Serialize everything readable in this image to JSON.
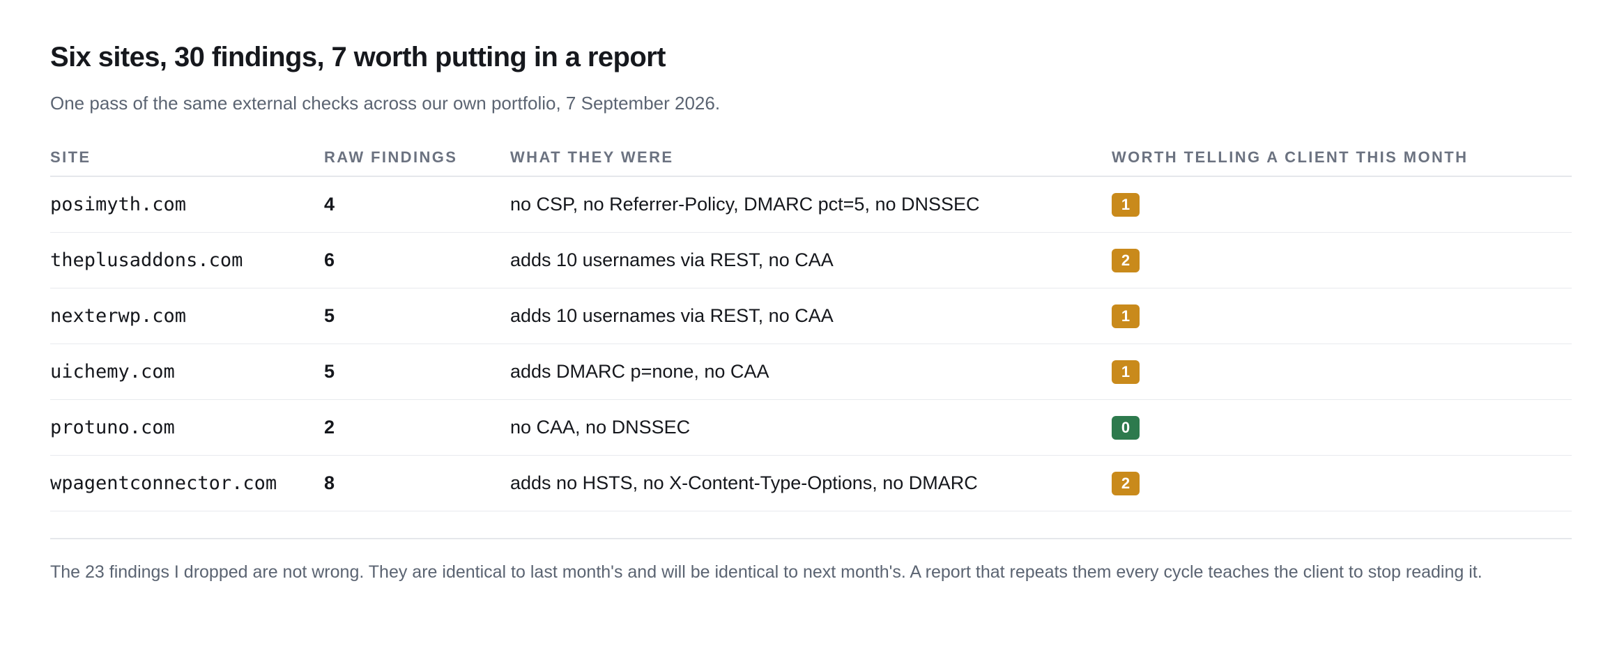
{
  "report": {
    "title": "Six sites, 30 findings, 7 worth putting in a report",
    "subtitle": "One pass of the same external checks across our own portfolio, 7 September 2026."
  },
  "table": {
    "headers": {
      "site": "SITE",
      "raw": "RAW FINDINGS",
      "what": "WHAT THEY WERE",
      "worth": "WORTH TELLING A CLIENT THIS MONTH"
    },
    "rows": [
      {
        "site": "posimyth.com",
        "raw": "4",
        "what": "no CSP, no Referrer-Policy, DMARC pct=5, no DNSSEC",
        "worth": "1",
        "badge_color": "#c98a1b"
      },
      {
        "site": "theplusaddons.com",
        "raw": "6",
        "what": "adds 10 usernames via REST, no CAA",
        "worth": "2",
        "badge_color": "#c98a1b"
      },
      {
        "site": "nexterwp.com",
        "raw": "5",
        "what": "adds 10 usernames via REST, no CAA",
        "worth": "1",
        "badge_color": "#c98a1b"
      },
      {
        "site": "uichemy.com",
        "raw": "5",
        "what": "adds DMARC p=none, no CAA",
        "worth": "1",
        "badge_color": "#c98a1b"
      },
      {
        "site": "protuno.com",
        "raw": "2",
        "what": "no CAA, no DNSSEC",
        "worth": "0",
        "badge_color": "#2d7a4d"
      },
      {
        "site": "wpagentconnector.com",
        "raw": "8",
        "what": "adds no HSTS, no X-Content-Type-Options, no DMARC",
        "worth": "2",
        "badge_color": "#c98a1b"
      }
    ]
  },
  "footnote": "The 23 findings I dropped are not wrong. They are identical to last month's and will be identical to next month's. A report that repeats them every cycle teaches the client to stop reading it.",
  "colors": {
    "worth_badge": "#c98a1b",
    "zero_badge": "#2d7a4d"
  }
}
